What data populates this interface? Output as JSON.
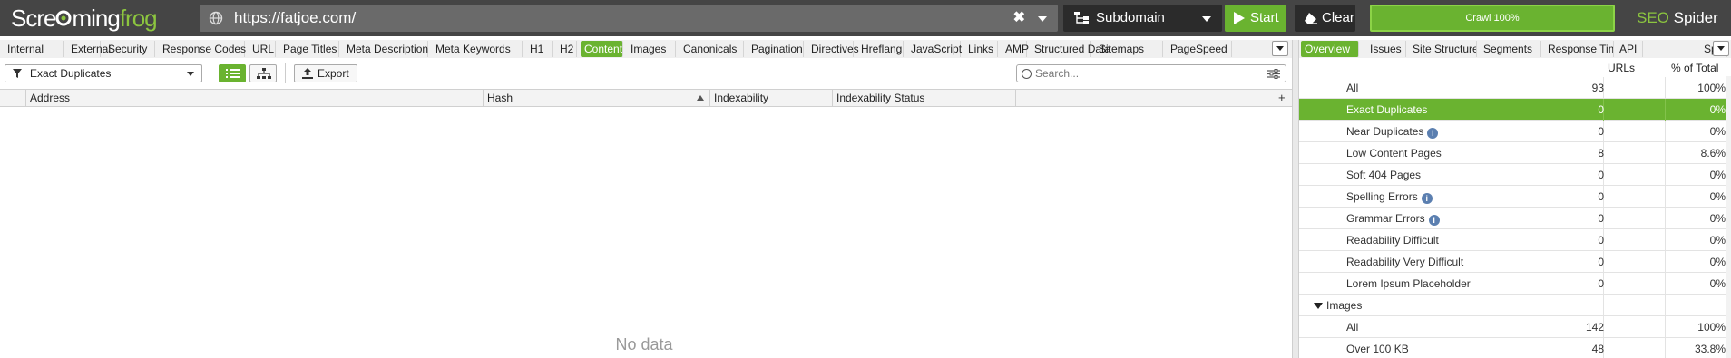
{
  "app": {
    "logo_pre": "Scre",
    "logo_mid": "ming",
    "logo_frog": "frog",
    "brand_seo": "SEO",
    "brand_spider": "Spider"
  },
  "toolbar": {
    "url": "https://fatjoe.com/",
    "mode": "Subdomain",
    "start_label": "Start",
    "clear_label": "Clear",
    "crawl_progress_label": "Crawl 100%",
    "crawl_progress": 1.0
  },
  "left_tabs": [
    {
      "label": "Internal"
    },
    {
      "label": "External"
    },
    {
      "label": "Security"
    },
    {
      "label": "Response Codes"
    },
    {
      "label": "URL"
    },
    {
      "label": "Page Titles"
    },
    {
      "label": "Meta Description"
    },
    {
      "label": "Meta Keywords"
    },
    {
      "label": "H1"
    },
    {
      "label": "H2"
    },
    {
      "label": "Content",
      "active": true
    },
    {
      "label": "Images"
    },
    {
      "label": "Canonicals"
    },
    {
      "label": "Pagination"
    },
    {
      "label": "Directives"
    },
    {
      "label": "Hreflang"
    },
    {
      "label": "JavaScript"
    },
    {
      "label": "Links"
    },
    {
      "label": "AMP"
    },
    {
      "label": "Structured Data"
    },
    {
      "label": "Sitemaps"
    },
    {
      "label": "PageSpeed"
    }
  ],
  "right_tabs": [
    {
      "label": "Overview",
      "active": true
    },
    {
      "label": "Issues"
    },
    {
      "label": "Site Structure"
    },
    {
      "label": "Segments"
    },
    {
      "label": "Response Times"
    },
    {
      "label": "API"
    },
    {
      "label": "Spelling &"
    }
  ],
  "filter": {
    "selected": "Exact Duplicates"
  },
  "export_label": "Export",
  "search": {
    "placeholder": "Search..."
  },
  "grid": {
    "columns": [
      "Address",
      "Hash",
      "Indexability",
      "Indexability Status"
    ],
    "empty_message": "No data"
  },
  "overview": {
    "headers": {
      "urls": "URLs",
      "pct": "% of Total"
    },
    "rows": [
      {
        "label": "All",
        "urls": "93",
        "pct": "100%"
      },
      {
        "label": "Exact Duplicates",
        "urls": "0",
        "pct": "0%",
        "selected": true
      },
      {
        "label": "Near Duplicates",
        "urls": "0",
        "pct": "0%",
        "info": true
      },
      {
        "label": "Low Content Pages",
        "urls": "8",
        "pct": "8.6%"
      },
      {
        "label": "Soft 404 Pages",
        "urls": "0",
        "pct": "0%"
      },
      {
        "label": "Spelling Errors",
        "urls": "0",
        "pct": "0%",
        "info": true
      },
      {
        "label": "Grammar Errors",
        "urls": "0",
        "pct": "0%",
        "info": true
      },
      {
        "label": "Readability Difficult",
        "urls": "0",
        "pct": "0%"
      },
      {
        "label": "Readability Very Difficult",
        "urls": "0",
        "pct": "0%"
      },
      {
        "label": "Lorem Ipsum Placeholder",
        "urls": "0",
        "pct": "0%"
      },
      {
        "label": "Images",
        "urls": "",
        "pct": "",
        "section": true
      },
      {
        "label": "All",
        "urls": "142",
        "pct": "100%"
      },
      {
        "label": "Over 100 KB",
        "urls": "48",
        "pct": "33.8%"
      }
    ]
  },
  "colors": {
    "accent": "#6ab330",
    "topbar": "#454545",
    "dark_button": "#2b2b2b"
  }
}
